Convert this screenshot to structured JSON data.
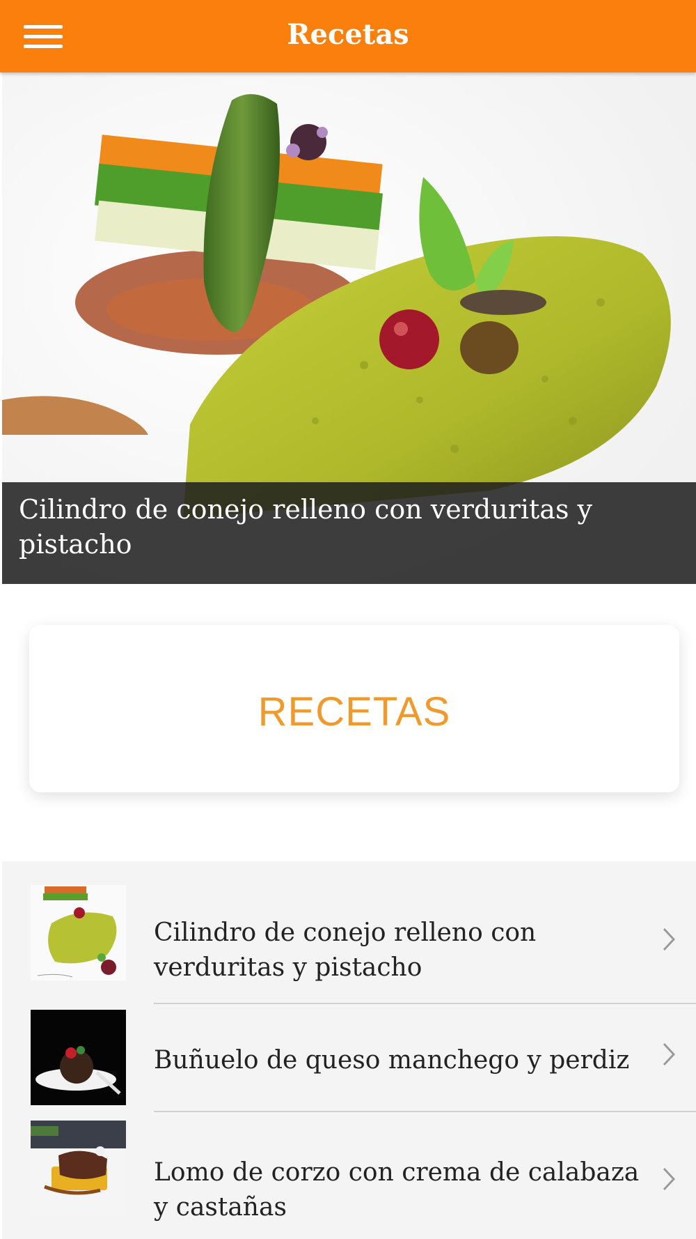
{
  "header": {
    "title": "Recetas",
    "menu_icon": "hamburger-menu-icon"
  },
  "hero": {
    "caption": "Cilindro de conejo relleno con verduritas y pistacho"
  },
  "section": {
    "label": "RECETAS"
  },
  "recipes": [
    {
      "title": "Cilindro de conejo relleno con verduritas y pistacho",
      "icon": "chevron-right-icon"
    },
    {
      "title": "Buñuelo de queso manchego y perdiz",
      "icon": "chevron-right-icon"
    },
    {
      "title": "Lomo de corzo con crema de calabaza y castañas",
      "icon": "chevron-right-icon"
    }
  ],
  "colors": {
    "accent": "#fb7f0c",
    "section_label": "#f09a2e",
    "list_background": "#f4f4f4"
  }
}
